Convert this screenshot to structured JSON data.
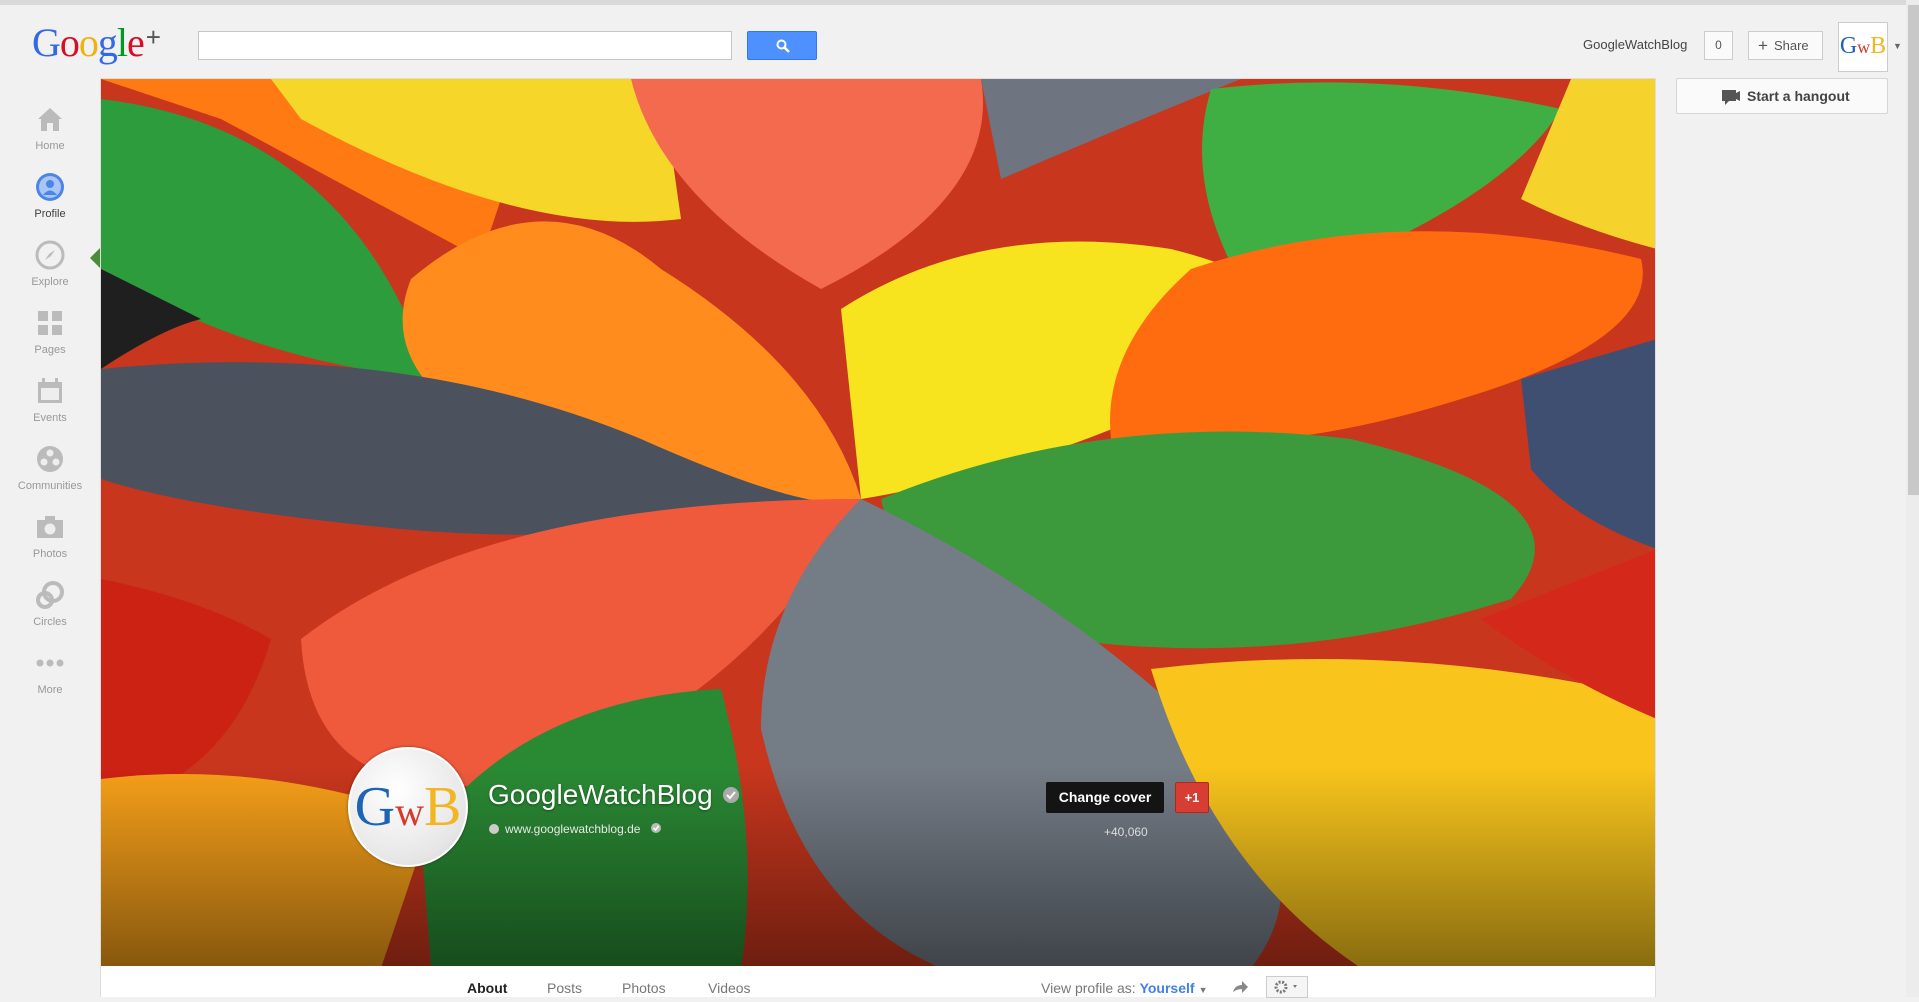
{
  "header": {
    "logo_text": "Google",
    "logo_plus": "+",
    "search_placeholder": "",
    "account_name": "GoogleWatchBlog",
    "notification_count": "0",
    "share_label": "Share",
    "avatar_text": "GwB"
  },
  "sidebar": {
    "items": [
      {
        "label": "Home",
        "icon": "home-icon"
      },
      {
        "label": "Profile",
        "icon": "profile-icon"
      },
      {
        "label": "Explore",
        "icon": "compass-icon"
      },
      {
        "label": "Pages",
        "icon": "pages-icon"
      },
      {
        "label": "Events",
        "icon": "calendar-icon"
      },
      {
        "label": "Communities",
        "icon": "communities-icon"
      },
      {
        "label": "Photos",
        "icon": "camera-icon"
      },
      {
        "label": "Circles",
        "icon": "circles-icon"
      },
      {
        "label": "More",
        "icon": "more-icon"
      }
    ],
    "active": "Profile"
  },
  "profile": {
    "name": "GoogleWatchBlog",
    "url": "www.googlewatchblog.de",
    "avatar_text": "GwB",
    "change_cover_label": "Change cover",
    "plusone_label": "+1",
    "plusone_count": "+40,060"
  },
  "tabs": [
    {
      "label": "About",
      "active": true
    },
    {
      "label": "Posts",
      "active": false
    },
    {
      "label": "Photos",
      "active": false
    },
    {
      "label": "Videos",
      "active": false
    }
  ],
  "view_profile": {
    "label": "View profile as:",
    "value": "Yourself"
  },
  "hangout": {
    "label": "Start a hangout"
  },
  "colors": {
    "accent_blue": "#4d90fe",
    "plusone_red": "#d73d32",
    "active_green": "#4a8c3a"
  }
}
